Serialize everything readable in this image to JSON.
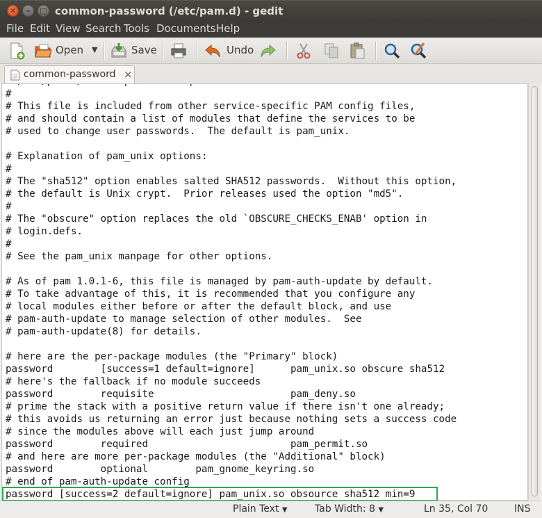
{
  "window": {
    "title": "common-password (/etc/pam.d) - gedit"
  },
  "menubar": {
    "items": [
      "File",
      "Edit",
      "View",
      "Search",
      "Tools",
      "Documents",
      "Help"
    ]
  },
  "toolbar": {
    "open_label": "Open",
    "save_label": "Save",
    "undo_label": "Undo"
  },
  "tab": {
    "label": "common-password",
    "close": "×"
  },
  "editor": {
    "lines": [
      "# /etc/pam.d/common-password - password-related modules common to all services",
      "#",
      "# This file is included from other service-specific PAM config files,",
      "# and should contain a list of modules that define the services to be",
      "# used to change user passwords.  The default is pam_unix.",
      "",
      "# Explanation of pam_unix options:",
      "#",
      "# The \"sha512\" option enables salted SHA512 passwords.  Without this option,",
      "# the default is Unix crypt.  Prior releases used the option \"md5\".",
      "#",
      "# The \"obscure\" option replaces the old `OBSCURE_CHECKS_ENAB' option in",
      "# login.defs.",
      "#",
      "# See the pam_unix manpage for other options.",
      "",
      "# As of pam 1.0.1-6, this file is managed by pam-auth-update by default.",
      "# To take advantage of this, it is recommended that you configure any",
      "# local modules either before or after the default block, and use",
      "# pam-auth-update to manage selection of other modules.  See",
      "# pam-auth-update(8) for details.",
      "",
      "# here are the per-package modules (the \"Primary\" block)",
      "password        [success=1 default=ignore]      pam_unix.so obscure sha512",
      "# here's the fallback if no module succeeds",
      "password        requisite                       pam_deny.so",
      "# prime the stack with a positive return value if there isn't one already;",
      "# this avoids us returning an error just because nothing sets a success code",
      "# since the modules above will each just jump around",
      "password        required                        pam_permit.so",
      "# and here are more per-package modules (the \"Additional\" block)",
      "password        optional        pam_gnome_keyring.so",
      "# end of pam-auth-update config",
      "password [success=2 default=ignore] pam_unix.so obsource sha512 min=9"
    ]
  },
  "statusbar": {
    "language": "Plain Text",
    "tab_width": "Tab Width: 8",
    "position": "Ln 35, Col 70",
    "mode": "INS"
  },
  "colors": {
    "highlight_box": "#2ea84a",
    "titlebar": "#3c3b37",
    "close_button": "#e95420"
  }
}
